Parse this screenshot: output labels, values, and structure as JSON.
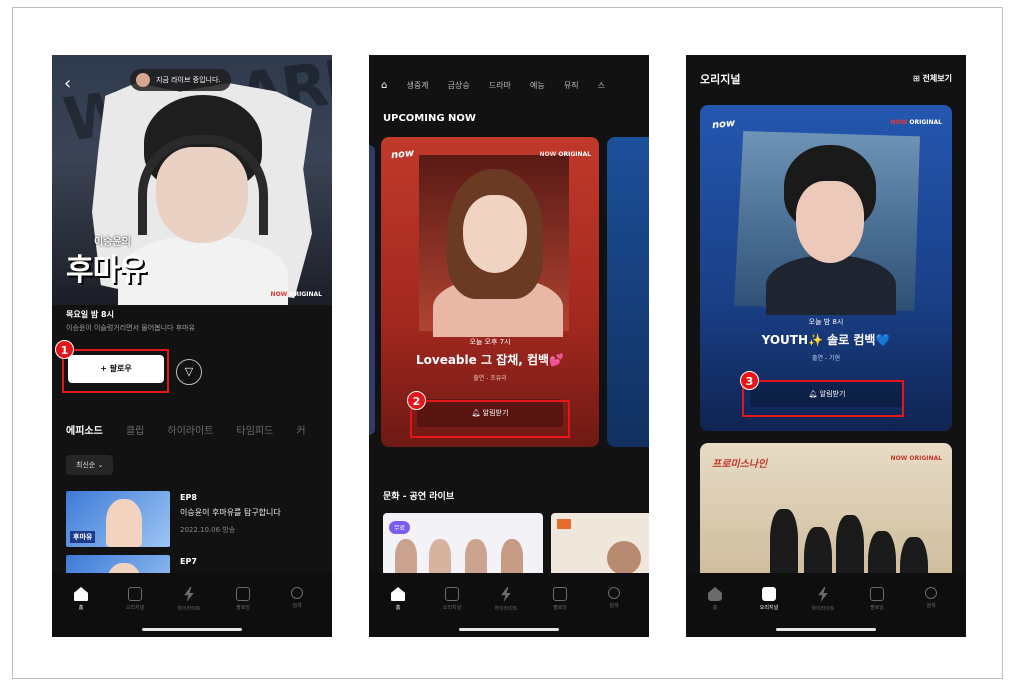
{
  "screen1": {
    "live_banner": "지금 라이브 중입니다.",
    "show_subtitle": "이승윤의",
    "show_title": "후마유",
    "original_badge": {
      "brand": "NOW",
      "label": "ORIGINAL"
    },
    "schedule": "목요일 밤 8시",
    "description": "이승윤이 이슬렁거리면서 물어봅니다 후마유",
    "follow_button": "+ 팔로우",
    "tabs": [
      "에피소드",
      "클립",
      "하이라이트",
      "타임피드",
      "커"
    ],
    "sort_label": "최신순",
    "episodes": [
      {
        "number": "EP8",
        "title": "이승윤이 후마유를 탐구합니다",
        "date": "2022.10.06 방송",
        "thumb_text": "후마유"
      },
      {
        "number": "EP7",
        "title": "",
        "date": "",
        "thumb_text": ""
      }
    ]
  },
  "screen2": {
    "top_nav": [
      "생중계",
      "금상승",
      "드라마",
      "예능",
      "뮤직",
      "스"
    ],
    "section_title": "UPCOMING NOW",
    "card": {
      "logo": "now",
      "original_badge": {
        "brand": "NOW",
        "label": "ORIGINAL"
      },
      "time": "오늘 오후 7시",
      "title": "Loveable 그 잡채, 컴백💕",
      "cast": "출연 - 조유리",
      "notify_button": "알림받기"
    },
    "second_section_title": "문화 - 공연 라이브",
    "thumb_badge": "무료"
  },
  "screen3": {
    "header_title": "오리지널",
    "header_right": "전체보기",
    "card": {
      "logo": "now",
      "original_badge": {
        "brand": "NOW",
        "label": "ORIGINAL"
      },
      "time": "오늘 밤 8시",
      "title": "YOUTH✨ 솔로 컴백💙",
      "cast": "출연 - 기현",
      "notify_button": "알림받기"
    },
    "card2": {
      "logo": "프로미스나인",
      "original_badge": {
        "brand": "NOW",
        "label": "ORIGINAL"
      }
    }
  },
  "bottom_nav": [
    "홈",
    "오리지널",
    "하이라이트",
    "팔로잉",
    "검색"
  ],
  "annotations": [
    "1",
    "2",
    "3"
  ],
  "colors": {
    "highlight": "#e5161a",
    "background": "#121212",
    "accent_red": "#e53935"
  }
}
